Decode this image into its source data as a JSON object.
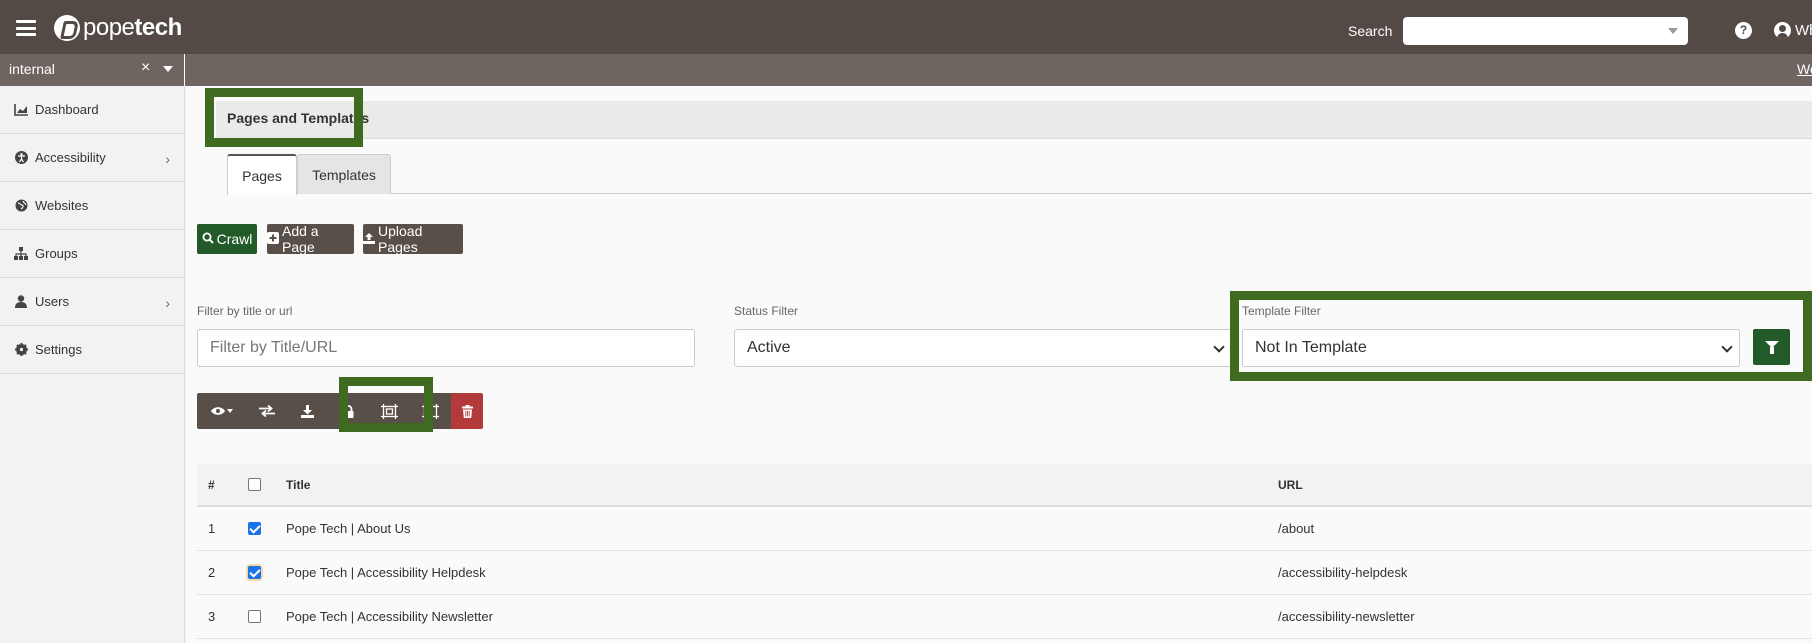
{
  "header": {
    "logo_prefix": "pope",
    "logo_bold": "tech",
    "search_label": "Search",
    "search_value": "",
    "help_icon": "?",
    "user_name": "Wh"
  },
  "subbar": {
    "account_value": "internal",
    "clear_symbol": "×",
    "right_link": "We"
  },
  "sidebar": {
    "items": [
      {
        "label": "Dashboard",
        "icon": "chart-icon",
        "has_arrow": false
      },
      {
        "label": "Accessibility",
        "icon": "accessibility-icon",
        "has_arrow": true
      },
      {
        "label": "Websites",
        "icon": "globe-icon",
        "has_arrow": false
      },
      {
        "label": "Groups",
        "icon": "sitemap-icon",
        "has_arrow": false
      },
      {
        "label": "Users",
        "icon": "user-icon",
        "has_arrow": true
      },
      {
        "label": "Settings",
        "icon": "gear-icon",
        "has_arrow": false
      }
    ],
    "arrow": "›"
  },
  "main": {
    "title": "Pages and Templates",
    "tabs": [
      {
        "label": "Pages",
        "active": true
      },
      {
        "label": "Templates",
        "active": false
      }
    ],
    "actions": {
      "crawl": "Crawl",
      "add_page": "Add a Page",
      "upload_pages": "Upload Pages"
    },
    "filters": {
      "title_label": "Filter by title or url",
      "title_placeholder": "Filter by Title/URL",
      "status_label": "Status Filter",
      "status_value": "Active",
      "template_label": "Template Filter",
      "template_value": "Not In Template"
    },
    "table": {
      "headers": {
        "num": "#",
        "title": "Title",
        "url": "URL"
      },
      "rows": [
        {
          "num": "1",
          "title": "Pope Tech | About Us",
          "url": "/about",
          "checked": true
        },
        {
          "num": "2",
          "title": "Pope Tech | Accessibility Helpdesk",
          "url": "/accessibility-helpdesk",
          "checked": true
        },
        {
          "num": "3",
          "title": "Pope Tech | Accessibility Newsletter",
          "url": "/accessibility-newsletter",
          "checked": false
        }
      ]
    }
  },
  "colors": {
    "navbar": "#534a45",
    "subbar": "#6e6560",
    "primary_green": "#235a2a",
    "highlight_green": "#3e6b1f",
    "danger": "#b33a3a"
  }
}
